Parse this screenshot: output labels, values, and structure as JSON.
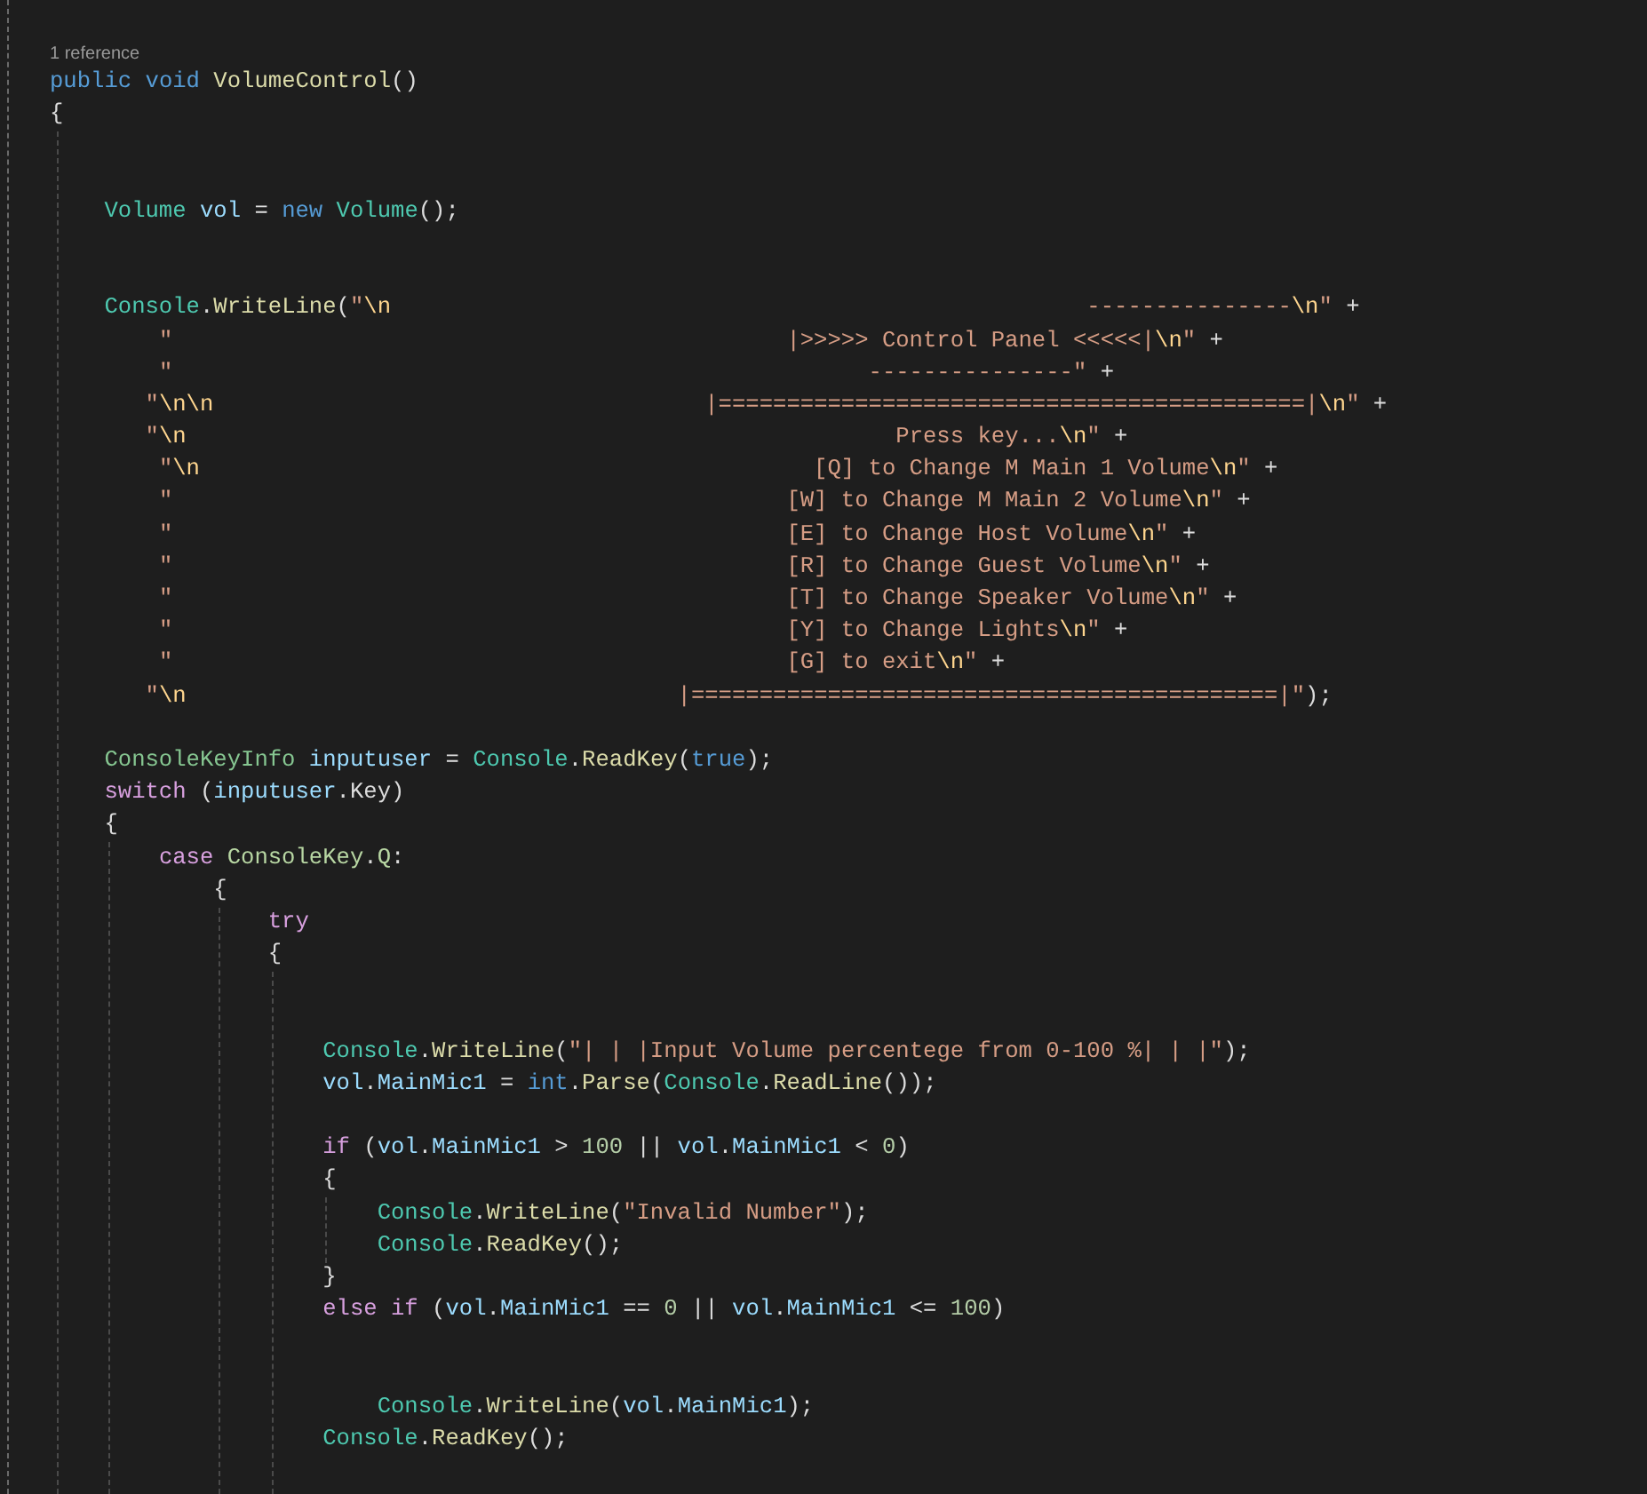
{
  "editor": {
    "codelens": "1 reference",
    "lines": [
      {
        "kind": "code",
        "tokens": [
          {
            "kind": "kw",
            "text": "public "
          },
          {
            "kind": "kw",
            "text": "void "
          },
          {
            "kind": "method",
            "text": "VolumeControl"
          },
          {
            "kind": "plain",
            "text": "()"
          }
        ]
      },
      {
        "kind": "code",
        "tokens": [
          {
            "kind": "plain",
            "text": "{"
          }
        ]
      },
      {
        "kind": "blank"
      },
      {
        "kind": "blank"
      },
      {
        "kind": "code",
        "tokens": [
          {
            "kind": "type",
            "text": "    Volume "
          },
          {
            "kind": "var",
            "text": "vol"
          },
          {
            "kind": "plain",
            "text": " = "
          },
          {
            "kind": "kw",
            "text": "new "
          },
          {
            "kind": "type",
            "text": "Volume"
          },
          {
            "kind": "plain",
            "text": "();"
          }
        ]
      },
      {
        "kind": "blank"
      },
      {
        "kind": "blank"
      },
      {
        "kind": "code",
        "tokens": [
          {
            "kind": "type",
            "text": "    Console"
          },
          {
            "kind": "plain",
            "text": "."
          },
          {
            "kind": "method",
            "text": "WriteLine"
          },
          {
            "kind": "plain",
            "text": "("
          },
          {
            "kind": "str",
            "text": "\""
          },
          {
            "kind": "esc",
            "text": "\\n"
          },
          {
            "kind": "str",
            "text": "                                                   ---------------"
          },
          {
            "kind": "esc",
            "text": "\\n"
          },
          {
            "kind": "str",
            "text": "\""
          },
          {
            "kind": "plain",
            "text": " +"
          }
        ]
      },
      {
        "kind": "code",
        "tokens": [
          {
            "kind": "str",
            "text": "        \"                                             |>>>>> Control Panel <<<<<|"
          },
          {
            "kind": "esc",
            "text": "\\n"
          },
          {
            "kind": "str",
            "text": "\""
          },
          {
            "kind": "plain",
            "text": " +"
          }
        ]
      },
      {
        "kind": "code",
        "tokens": [
          {
            "kind": "str",
            "text": "        \"                                                   ---------------\""
          },
          {
            "kind": "plain",
            "text": " +"
          }
        ]
      },
      {
        "kind": "code",
        "tokens": [
          {
            "kind": "str",
            "text": "       \""
          },
          {
            "kind": "esc",
            "text": "\\n\\n"
          },
          {
            "kind": "str",
            "text": "                                    |===========================================|"
          },
          {
            "kind": "esc",
            "text": "\\n"
          },
          {
            "kind": "str",
            "text": "\""
          },
          {
            "kind": "plain",
            "text": " +"
          }
        ]
      },
      {
        "kind": "code",
        "tokens": [
          {
            "kind": "str",
            "text": "       \""
          },
          {
            "kind": "esc",
            "text": "\\n"
          },
          {
            "kind": "str",
            "text": "                                                    Press key..."
          },
          {
            "kind": "esc",
            "text": "\\n"
          },
          {
            "kind": "str",
            "text": "\""
          },
          {
            "kind": "plain",
            "text": " +"
          }
        ]
      },
      {
        "kind": "code",
        "tokens": [
          {
            "kind": "str",
            "text": "        \""
          },
          {
            "kind": "esc",
            "text": "\\n"
          },
          {
            "kind": "str",
            "text": "                                             [Q] to Change M Main 1 Volume"
          },
          {
            "kind": "esc",
            "text": "\\n"
          },
          {
            "kind": "str",
            "text": "\""
          },
          {
            "kind": "plain",
            "text": " +"
          }
        ]
      },
      {
        "kind": "code",
        "tokens": [
          {
            "kind": "str",
            "text": "        \"                                             [W] to Change M Main 2 Volume"
          },
          {
            "kind": "esc",
            "text": "\\n"
          },
          {
            "kind": "str",
            "text": "\""
          },
          {
            "kind": "plain",
            "text": " +"
          }
        ]
      },
      {
        "kind": "code",
        "tokens": [
          {
            "kind": "str",
            "text": "        \"                                             [E] to Change Host Volume"
          },
          {
            "kind": "esc",
            "text": "\\n"
          },
          {
            "kind": "str",
            "text": "\""
          },
          {
            "kind": "plain",
            "text": " +"
          }
        ]
      },
      {
        "kind": "code",
        "tokens": [
          {
            "kind": "str",
            "text": "        \"                                             [R] to Change Guest Volume"
          },
          {
            "kind": "esc",
            "text": "\\n"
          },
          {
            "kind": "str",
            "text": "\""
          },
          {
            "kind": "plain",
            "text": " +"
          }
        ]
      },
      {
        "kind": "code",
        "tokens": [
          {
            "kind": "str",
            "text": "        \"                                             [T] to Change Speaker Volume"
          },
          {
            "kind": "esc",
            "text": "\\n"
          },
          {
            "kind": "str",
            "text": "\""
          },
          {
            "kind": "plain",
            "text": " +"
          }
        ]
      },
      {
        "kind": "code",
        "tokens": [
          {
            "kind": "str",
            "text": "        \"                                             [Y] to Change Lights"
          },
          {
            "kind": "esc",
            "text": "\\n"
          },
          {
            "kind": "str",
            "text": "\""
          },
          {
            "kind": "plain",
            "text": " +"
          }
        ]
      },
      {
        "kind": "code",
        "tokens": [
          {
            "kind": "str",
            "text": "        \"                                             [G] to exit"
          },
          {
            "kind": "esc",
            "text": "\\n"
          },
          {
            "kind": "str",
            "text": "\""
          },
          {
            "kind": "plain",
            "text": " +"
          }
        ]
      },
      {
        "kind": "code",
        "tokens": [
          {
            "kind": "str",
            "text": "       \""
          },
          {
            "kind": "esc",
            "text": "\\n"
          },
          {
            "kind": "str",
            "text": "                                    |===========================================|\""
          },
          {
            "kind": "plain",
            "text": ");"
          }
        ]
      },
      {
        "kind": "blank"
      },
      {
        "kind": "code",
        "tokens": [
          {
            "kind": "struct",
            "text": "    ConsoleKeyInfo "
          },
          {
            "kind": "var",
            "text": "inputuser"
          },
          {
            "kind": "plain",
            "text": " = "
          },
          {
            "kind": "type",
            "text": "Console"
          },
          {
            "kind": "plain",
            "text": "."
          },
          {
            "kind": "method",
            "text": "ReadKey"
          },
          {
            "kind": "plain",
            "text": "("
          },
          {
            "kind": "kw",
            "text": "true"
          },
          {
            "kind": "plain",
            "text": ");"
          }
        ]
      },
      {
        "kind": "code",
        "tokens": [
          {
            "kind": "ctrl",
            "text": "    switch"
          },
          {
            "kind": "plain",
            "text": " ("
          },
          {
            "kind": "var",
            "text": "inputuser"
          },
          {
            "kind": "plain",
            "text": ".Key)"
          }
        ]
      },
      {
        "kind": "code",
        "tokens": [
          {
            "kind": "plain",
            "text": "    {"
          }
        ]
      },
      {
        "kind": "code",
        "tokens": [
          {
            "kind": "ctrl",
            "text": "        case "
          },
          {
            "kind": "enum",
            "text": "ConsoleKey"
          },
          {
            "kind": "plain",
            "text": "."
          },
          {
            "kind": "enum",
            "text": "Q"
          },
          {
            "kind": "plain",
            "text": ":"
          }
        ]
      },
      {
        "kind": "code",
        "tokens": [
          {
            "kind": "plain",
            "text": "            {"
          }
        ]
      },
      {
        "kind": "code",
        "tokens": [
          {
            "kind": "ctrl",
            "text": "                try"
          }
        ]
      },
      {
        "kind": "code",
        "tokens": [
          {
            "kind": "plain",
            "text": "                {"
          }
        ]
      },
      {
        "kind": "blank"
      },
      {
        "kind": "blank"
      },
      {
        "kind": "code",
        "tokens": [
          {
            "kind": "type",
            "text": "                    Console"
          },
          {
            "kind": "plain",
            "text": "."
          },
          {
            "kind": "method",
            "text": "WriteLine"
          },
          {
            "kind": "plain",
            "text": "("
          },
          {
            "kind": "str",
            "text": "\"| | |Input Volume percentege from 0-100 %| | |\""
          },
          {
            "kind": "plain",
            "text": ");"
          }
        ]
      },
      {
        "kind": "code",
        "tokens": [
          {
            "kind": "var",
            "text": "                    vol"
          },
          {
            "kind": "plain",
            "text": "."
          },
          {
            "kind": "var",
            "text": "MainMic1"
          },
          {
            "kind": "plain",
            "text": " = "
          },
          {
            "kind": "kw",
            "text": "int"
          },
          {
            "kind": "plain",
            "text": "."
          },
          {
            "kind": "method",
            "text": "Parse"
          },
          {
            "kind": "plain",
            "text": "("
          },
          {
            "kind": "type",
            "text": "Console"
          },
          {
            "kind": "plain",
            "text": "."
          },
          {
            "kind": "method",
            "text": "ReadLine"
          },
          {
            "kind": "plain",
            "text": "());"
          }
        ]
      },
      {
        "kind": "blank"
      },
      {
        "kind": "code",
        "tokens": [
          {
            "kind": "ctrl",
            "text": "                    if"
          },
          {
            "kind": "plain",
            "text": " ("
          },
          {
            "kind": "var",
            "text": "vol"
          },
          {
            "kind": "plain",
            "text": "."
          },
          {
            "kind": "var",
            "text": "MainMic1"
          },
          {
            "kind": "plain",
            "text": " > "
          },
          {
            "kind": "num",
            "text": "100"
          },
          {
            "kind": "plain",
            "text": " || "
          },
          {
            "kind": "var",
            "text": "vol"
          },
          {
            "kind": "plain",
            "text": "."
          },
          {
            "kind": "var",
            "text": "MainMic1"
          },
          {
            "kind": "plain",
            "text": " < "
          },
          {
            "kind": "num",
            "text": "0"
          },
          {
            "kind": "plain",
            "text": ")"
          }
        ]
      },
      {
        "kind": "code",
        "tokens": [
          {
            "kind": "plain",
            "text": "                    {"
          }
        ]
      },
      {
        "kind": "code",
        "tokens": [
          {
            "kind": "type",
            "text": "                        Console"
          },
          {
            "kind": "plain",
            "text": "."
          },
          {
            "kind": "method",
            "text": "WriteLine"
          },
          {
            "kind": "plain",
            "text": "("
          },
          {
            "kind": "str",
            "text": "\"Invalid Number\""
          },
          {
            "kind": "plain",
            "text": ");"
          }
        ]
      },
      {
        "kind": "code",
        "tokens": [
          {
            "kind": "type",
            "text": "                        Console"
          },
          {
            "kind": "plain",
            "text": "."
          },
          {
            "kind": "method",
            "text": "ReadKey"
          },
          {
            "kind": "plain",
            "text": "();"
          }
        ]
      },
      {
        "kind": "code",
        "tokens": [
          {
            "kind": "plain",
            "text": "                    }"
          }
        ]
      },
      {
        "kind": "code",
        "tokens": [
          {
            "kind": "ctrl",
            "text": "                    else "
          },
          {
            "kind": "ctrl",
            "text": "if"
          },
          {
            "kind": "plain",
            "text": " ("
          },
          {
            "kind": "var",
            "text": "vol"
          },
          {
            "kind": "plain",
            "text": "."
          },
          {
            "kind": "var",
            "text": "MainMic1"
          },
          {
            "kind": "plain",
            "text": " == "
          },
          {
            "kind": "num",
            "text": "0"
          },
          {
            "kind": "plain",
            "text": " || "
          },
          {
            "kind": "var",
            "text": "vol"
          },
          {
            "kind": "plain",
            "text": "."
          },
          {
            "kind": "var",
            "text": "MainMic1"
          },
          {
            "kind": "plain",
            "text": " <= "
          },
          {
            "kind": "num",
            "text": "100"
          },
          {
            "kind": "plain",
            "text": ")"
          }
        ]
      },
      {
        "kind": "blank"
      },
      {
        "kind": "blank"
      },
      {
        "kind": "code",
        "tokens": [
          {
            "kind": "type",
            "text": "                        Console"
          },
          {
            "kind": "plain",
            "text": "."
          },
          {
            "kind": "method",
            "text": "WriteLine"
          },
          {
            "kind": "plain",
            "text": "("
          },
          {
            "kind": "var",
            "text": "vol"
          },
          {
            "kind": "plain",
            "text": "."
          },
          {
            "kind": "var",
            "text": "MainMic1"
          },
          {
            "kind": "plain",
            "text": ");"
          }
        ]
      },
      {
        "kind": "code",
        "tokens": [
          {
            "kind": "type",
            "text": "                    Console"
          },
          {
            "kind": "plain",
            "text": "."
          },
          {
            "kind": "method",
            "text": "ReadKey"
          },
          {
            "kind": "plain",
            "text": "();"
          }
        ]
      }
    ]
  }
}
